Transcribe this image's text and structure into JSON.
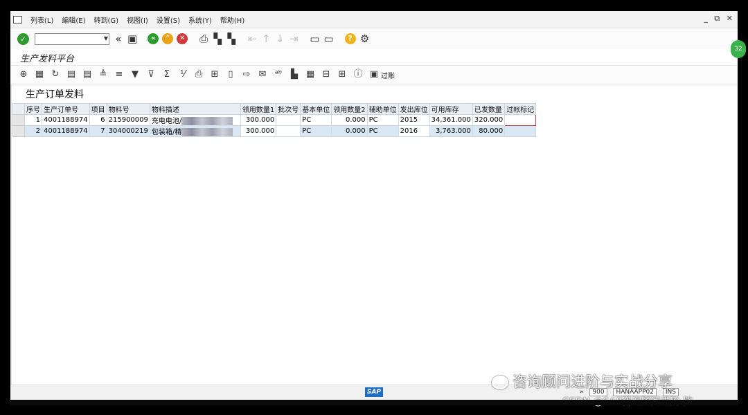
{
  "menu": {
    "items": [
      "列表(L)",
      "编辑(E)",
      "转到(G)",
      "视图(I)",
      "设置(S)",
      "系统(Y)",
      "帮助(H)"
    ],
    "window_controls": "_ ⧉ ✕"
  },
  "toolbar": {
    "command_field_value": "",
    "icons": [
      "enter-icon",
      "back-double-icon",
      "save-icon",
      "back-icon",
      "exit-icon",
      "cancel-icon",
      "print-icon",
      "find-icon",
      "find-next-icon",
      "first-page-icon",
      "prev-page-icon",
      "next-page-icon",
      "last-page-icon",
      "new-session-icon",
      "shortcut-icon",
      "help-icon",
      "settings-icon"
    ]
  },
  "title": "生产发料平台",
  "alv_toolbar": {
    "filter_label": "过账"
  },
  "list": {
    "title": "生产订单发料",
    "columns": [
      "序号",
      "生产订单号",
      "项目",
      "物料号",
      "物料描述",
      "领用数量1",
      "批次号",
      "基本单位",
      "领用数量2",
      "辅助单位",
      "发出库位",
      "可用库存",
      "已发数量",
      "过帐标记"
    ],
    "rows": [
      {
        "seq": "1",
        "order": "4001188974",
        "item": "6",
        "material": "215900009",
        "desc": "充电电池/",
        "qty1": "300.000",
        "batch": "",
        "base_unit": "PC",
        "qty2": "0.000",
        "aux_unit": "PC",
        "storage": "2015",
        "stock": "34,361.000",
        "issued": "320.000",
        "post_mark": ""
      },
      {
        "seq": "2",
        "order": "4001188974",
        "item": "7",
        "material": "304000219",
        "desc": "包装箱/精",
        "qty1": "300.000",
        "batch": "",
        "base_unit": "PC",
        "qty2": "0.000",
        "aux_unit": "PC",
        "storage": "2016",
        "stock": "3,763.000",
        "issued": "80.000",
        "post_mark": ""
      }
    ]
  },
  "status": {
    "client": "900",
    "server": "HANAAPP02",
    "mode": "INS",
    "sap_logo": "SAP"
  },
  "watermark": {
    "line1": "咨询顾问进阶与实战分享",
    "line2": "CSDN @SAP咨询顾问进阶-陈"
  },
  "badge": "32"
}
